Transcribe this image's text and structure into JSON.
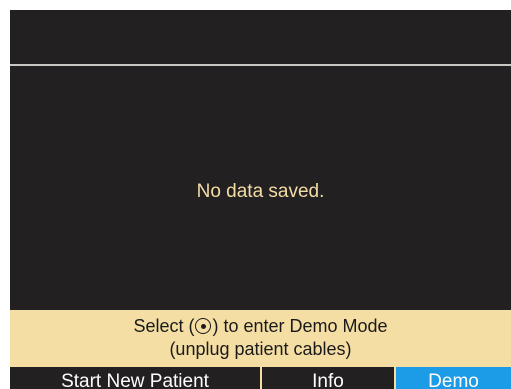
{
  "main": {
    "message": "No data saved."
  },
  "prompt": {
    "line1_before_icon": "Select (",
    "select_icon": "select-dot-icon",
    "line1_after_icon": ") to enter Demo Mode",
    "line2": "(unplug patient cables)"
  },
  "softkeys": [
    {
      "label": "Start New Patient",
      "selected": false
    },
    {
      "label": "Info",
      "selected": false
    },
    {
      "label": "Demo",
      "selected": true
    }
  ],
  "colors": {
    "screen_background": "#232021",
    "message_text": "#f3dca5",
    "prompt_background": "#f5dea3",
    "selected_softkey": "#1c9be6",
    "divider": "#c9c6c3"
  }
}
